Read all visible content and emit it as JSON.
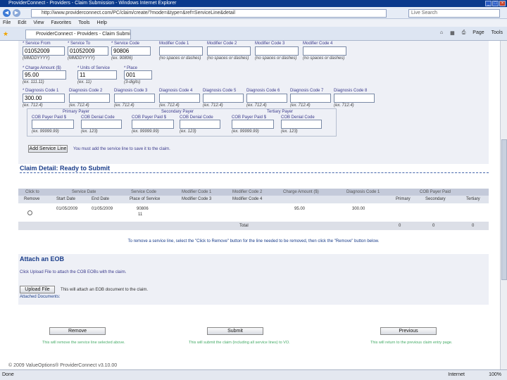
{
  "window": {
    "title": "ProviderConnect - Providers - Claim Submission - Windows Internet Explorer",
    "url": "http://www.providerconnect.com/PC/claim/create/?mode=&type=&ref=ServiceLine&detail",
    "search_placeholder": "Live Search",
    "menu": [
      "File",
      "Edit",
      "View",
      "Favorites",
      "Tools",
      "Help"
    ],
    "tab_label": "ProviderConnect - Providers - Claim Submission",
    "tools": [
      "Page",
      "Tools"
    ]
  },
  "service_line": {
    "labels": {
      "from_date": "* Service From",
      "to_date": "* Service To",
      "service_code": "* Service Code",
      "modifier_1": "Modifier Code 1",
      "modifier_2": "Modifier Code 2",
      "modifier_3": "Modifier Code 3",
      "modifier_4": "Modifier Code 4",
      "charge": "* Charge Amount ($)",
      "units": "* Units of Service",
      "place": "* Place",
      "dx1": "* Diagnosis Code 1",
      "dx2": "Diagnosis Code 2",
      "dx3": "Diagnosis Code 3",
      "dx4": "Diagnosis Code 4",
      "dx5": "Diagnosis Code 5",
      "dx6": "Diagnosis Code 6",
      "dx7": "Diagnosis Code 7",
      "dx8": "Diagnosis Code 8",
      "primary_payer": "Primary Payer",
      "secondary_payer": "Secondary Payer",
      "tertiary_payer": "Tertiary Payer",
      "cob_paid": "COB Payer Paid $",
      "cob_denial": "COB Denial Code",
      "cob_paid2": "COB Payer Paid $",
      "cob_denial2": "COB Denial Code",
      "cob_paid3": "COB Payer Paid $",
      "cob_denial3": "COB Denial Code"
    },
    "values": {
      "from_date": "01052009",
      "to_date": "01052009",
      "service_code": "90806",
      "charge": "95.00",
      "units": "11",
      "place": "001",
      "dx1": "300.00"
    },
    "hints": {
      "date": "(MMDDYYYY)",
      "code": "(ex. 90806)",
      "modifier": "(no spaces or dashes)",
      "amount": "(ex. 111.11)",
      "units": "(ex. 11)",
      "place": "(3-digits)",
      "dx": "(ex. 712.4)",
      "cob_paid": "(ex. 99999.99)",
      "cob_denial": "(ex. 123)"
    },
    "add_button": "Add Service Line",
    "add_note": "You must add the service line to save it to the claim."
  },
  "claim_detail": {
    "title": "Claim Detail: Ready to Submit",
    "header1": [
      "Click to",
      "Service Date",
      "Service Code",
      "Modifier Code 1",
      "Modifier Code 2",
      "Charge Amount ($)",
      "Diagnosis Code 1",
      "COB Payer Paid"
    ],
    "header2": [
      "Remove",
      "Start Date",
      "End Date",
      "Place of Service",
      "Modifier Code 3",
      "Modifier Code 4",
      "Primary",
      "Secondary",
      "Tertiary"
    ],
    "row": {
      "start": "01/05/2009",
      "end": "01/05/2009",
      "code": "90806",
      "place": "11",
      "charge": "95.00",
      "dx": "300.00"
    },
    "total_label": "Total",
    "totals": [
      "0",
      "0",
      "0"
    ],
    "instruction": "To remove a service line, select the \"Click to Remove\" button for the line needed to be removed, then click the \"Remove\" button below."
  },
  "attach": {
    "title": "Attach an EOB",
    "note": "Click Upload File to attach the COB EOBs with the claim.",
    "upload_button": "Upload File",
    "upload_note": "This will attach an EOB document to the claim.",
    "attached_label": "Attached Documents:"
  },
  "footer": {
    "remove": "Remove",
    "submit": "Submit",
    "previous": "Previous",
    "remove_note": "This will remove the service line selected above.",
    "submit_note": "This will submit the claim (including all service lines) to VO.",
    "previous_note": "This will return to the previous claim entry page.",
    "copyright": "© 2009 ValueOptions® ProviderConnect v3.10.00"
  },
  "status": {
    "text": "Done",
    "zone": "Internet",
    "zoom": "100%"
  }
}
